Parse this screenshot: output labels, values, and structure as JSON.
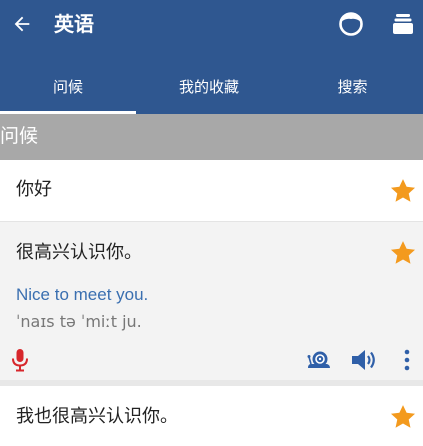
{
  "toolbar": {
    "title": "英语",
    "back_icon": "arrow-left-icon",
    "icons": [
      "face-icon",
      "stack-icon"
    ]
  },
  "tabs": [
    {
      "label": "问候",
      "active": true
    },
    {
      "label": "我的收藏",
      "active": false
    },
    {
      "label": "搜索",
      "active": false
    }
  ],
  "section": {
    "title": "问候"
  },
  "phrases": [
    {
      "chinese": "你好",
      "favorite": true
    },
    {
      "chinese": "很高兴认识你。",
      "english": "Nice to meet you.",
      "ipa": "ˈnaɪs tə ˈmiːt ju.",
      "favorite": true,
      "expanded": true
    },
    {
      "chinese": "我也很高兴认识你。",
      "favorite": true
    }
  ],
  "actions": {
    "record_icon": "microphone-icon",
    "slow_icon": "snail-icon",
    "play_icon": "speaker-icon",
    "more_icon": "more-vertical-icon"
  },
  "colors": {
    "appbar": "#2f5790",
    "section_header": "#a8a8a8",
    "star": "#f39a1e",
    "english_text": "#3a6fb0",
    "mic": "#d7262b",
    "action_blue": "#2f5fa8"
  }
}
